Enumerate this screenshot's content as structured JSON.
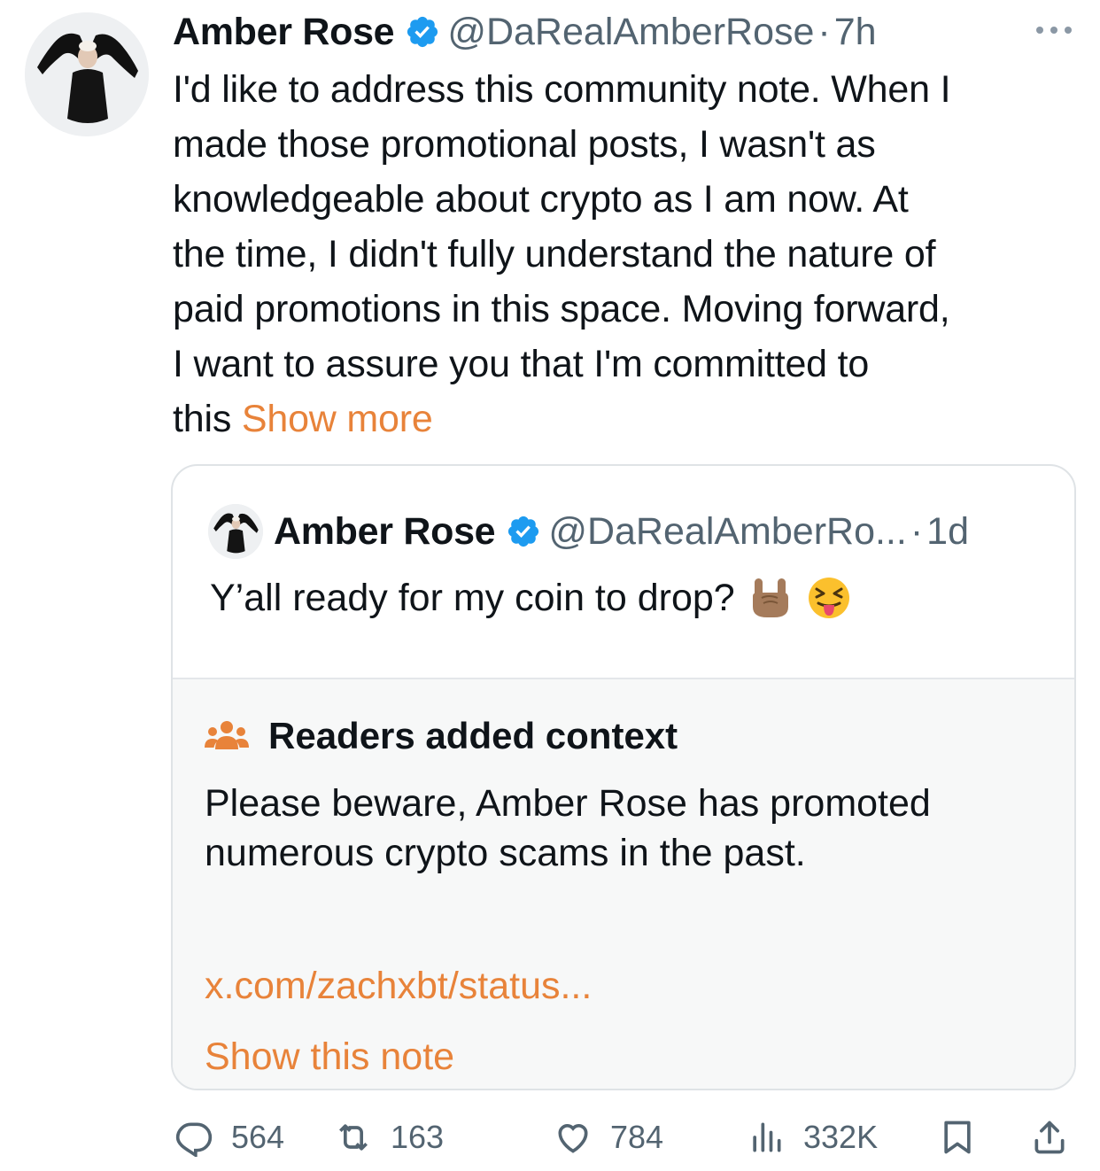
{
  "tweet": {
    "author_name": "Amber Rose",
    "handle": "@DaRealAmberRose",
    "separator": "·",
    "time": "7h",
    "text_lines": [
      "I'd like to address this community note. When I",
      "made those promotional posts, I wasn't as",
      "knowledgeable about crypto as I am now. At",
      "the time, I didn't fully understand the nature of",
      "paid promotions in this space. Moving forward,",
      "I want to assure you that I'm committed to",
      "this"
    ],
    "show_more": "Show more"
  },
  "quote": {
    "author_name": "Amber Rose",
    "handle": "@DaRealAmberRo...",
    "separator": "·",
    "time": "1d",
    "text": "Y’all ready for my coin to drop?",
    "emojis": [
      "sign-of-the-horns",
      "squinting-face-with-tongue"
    ]
  },
  "community_note": {
    "title": "Readers added context",
    "body_lines": [
      "Please beware, Amber Rose has promoted",
      "numerous crypto scams in the past."
    ],
    "link": "x.com/zachxbt/status...",
    "show_note": "Show this note"
  },
  "actions": {
    "replies": "564",
    "reposts": "163",
    "likes": "784",
    "views": "332K"
  },
  "colors": {
    "accent": "#e8833a",
    "verified": "#1d9bf0",
    "muted": "#536471",
    "note_bg": "#f7f8f8"
  }
}
